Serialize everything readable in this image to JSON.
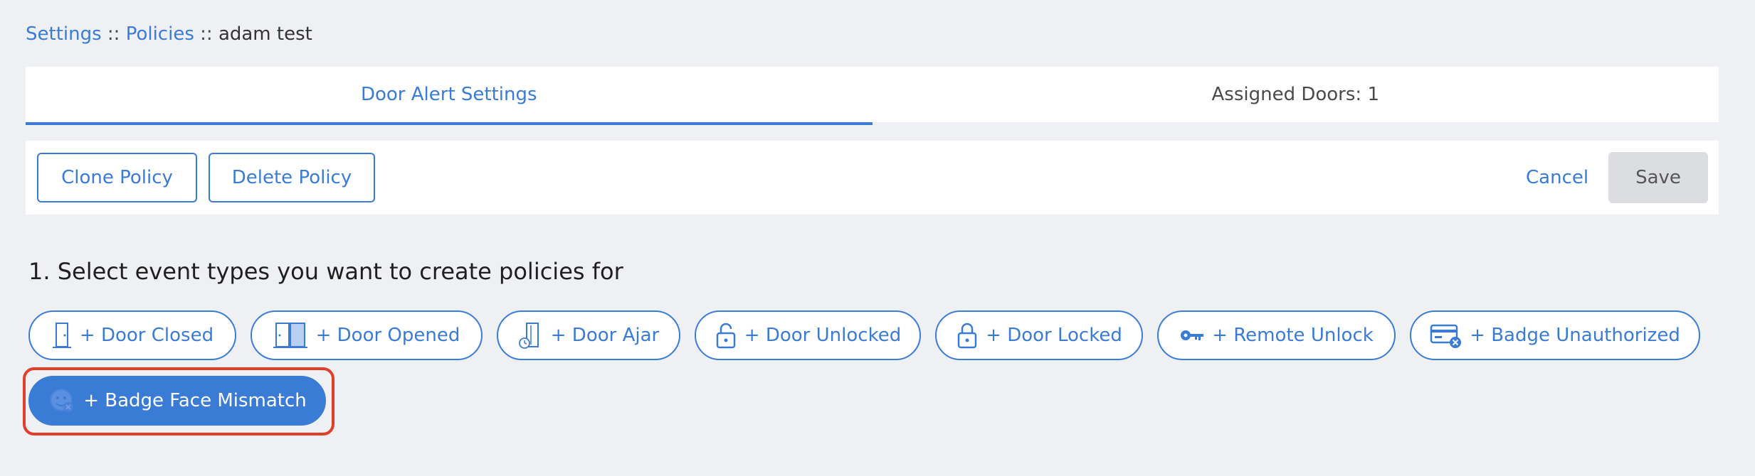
{
  "breadcrumb": {
    "settings": "Settings",
    "policies": "Policies",
    "current": "adam test",
    "separator": "::"
  },
  "tabs": [
    {
      "label": "Door Alert Settings",
      "active": true
    },
    {
      "label": "Assigned Doors: 1",
      "active": false
    }
  ],
  "toolbar": {
    "clone_label": "Clone Policy",
    "delete_label": "Delete Policy",
    "cancel_label": "Cancel",
    "save_label": "Save"
  },
  "section": {
    "title": "1. Select event types you want to create policies for"
  },
  "event_types": [
    {
      "label": "+ Door Closed",
      "icon": "door-closed-icon",
      "selected": false
    },
    {
      "label": "+ Door Opened",
      "icon": "door-opened-icon",
      "selected": false
    },
    {
      "label": "+ Door Ajar",
      "icon": "door-ajar-icon",
      "selected": false
    },
    {
      "label": "+ Door Unlocked",
      "icon": "unlocked-icon",
      "selected": false
    },
    {
      "label": "+ Door Locked",
      "icon": "locked-icon",
      "selected": false
    },
    {
      "label": "+ Remote Unlock",
      "icon": "key-icon",
      "selected": false
    },
    {
      "label": "+ Badge Unauthorized",
      "icon": "badge-unauthorized-icon",
      "selected": false
    },
    {
      "label": "+ Badge Face Mismatch",
      "icon": "face-mismatch-icon",
      "selected": true
    }
  ],
  "colors": {
    "accent": "#3a7bd5",
    "highlight": "#e0402a",
    "background": "#eff0f3"
  }
}
